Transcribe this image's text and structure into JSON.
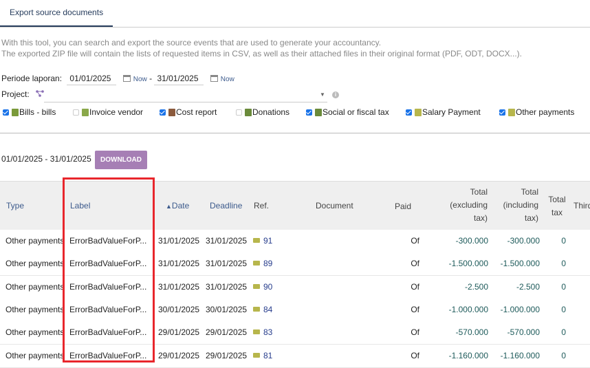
{
  "tab": {
    "label": "Export source documents"
  },
  "description": {
    "line1": "With this tool, you can search and export the source events that are used to generate your accountancy.",
    "line2": "The exported ZIP file will contain the lists of requested items in CSV, as well as their attached files in their original format (PDF, ODT, DOCX...)."
  },
  "period": {
    "label": "Periode laporan:",
    "start": "01/01/2025",
    "end": "31/01/2025",
    "separator": "-",
    "now": "Now"
  },
  "project": {
    "label": "Project:"
  },
  "types": [
    {
      "label": "Bills - bills",
      "checked": true,
      "color": "#7a9a3a"
    },
    {
      "label": "Invoice vendor",
      "checked": false,
      "color": "#8aa84a"
    },
    {
      "label": "Cost report",
      "checked": true,
      "color": "#8b5a3c"
    },
    {
      "label": "Donations",
      "checked": false,
      "color": "#6a8a3a"
    },
    {
      "label": "Social or fiscal tax",
      "checked": true,
      "color": "#6a8a3a"
    },
    {
      "label": "Salary Payment",
      "checked": true,
      "color": "#b7b64c"
    },
    {
      "label": "Other payments",
      "checked": true,
      "color": "#b7b64c"
    }
  ],
  "range_text": "01/01/2025 - 31/01/2025",
  "download_label": "DOWNLOAD",
  "columns": {
    "type": "Type",
    "label": "Label",
    "date": "Date",
    "sort_arrow": "▲",
    "deadline": "Deadline",
    "ref": "Ref.",
    "document": "Document",
    "paid": "Paid",
    "total_excl": [
      "Total",
      "(excluding",
      "tax)"
    ],
    "total_incl": [
      "Total",
      "(including",
      "tax)"
    ],
    "total_tax": [
      "Total",
      "tax"
    ],
    "third": "Third"
  },
  "rows": [
    {
      "type": "Other payments",
      "label": "ErrorBadValueForP...",
      "date": "31/01/2025",
      "deadline": "31/01/2025",
      "ref": "91",
      "paid": "Of",
      "excl": "-300.000",
      "incl": "-300.000",
      "tax": "0"
    },
    {
      "type": "Other payments",
      "label": "ErrorBadValueForP...",
      "date": "31/01/2025",
      "deadline": "31/01/2025",
      "ref": "89",
      "paid": "Of",
      "excl": "-1.500.000",
      "incl": "-1.500.000",
      "tax": "0"
    },
    {
      "type": "Other payments",
      "label": "ErrorBadValueForP...",
      "date": "31/01/2025",
      "deadline": "31/01/2025",
      "ref": "90",
      "paid": "Of",
      "excl": "-2.500",
      "incl": "-2.500",
      "tax": "0"
    },
    {
      "type": "Other payments",
      "label": "ErrorBadValueForP...",
      "date": "30/01/2025",
      "deadline": "30/01/2025",
      "ref": "84",
      "paid": "Of",
      "excl": "-1.000.000",
      "incl": "-1.000.000",
      "tax": "0"
    },
    {
      "type": "Other payments",
      "label": "ErrorBadValueForP...",
      "date": "29/01/2025",
      "deadline": "29/01/2025",
      "ref": "83",
      "paid": "Of",
      "excl": "-570.000",
      "incl": "-570.000",
      "tax": "0"
    },
    {
      "type": "Other payments",
      "label": "ErrorBadValueForP...",
      "date": "29/01/2025",
      "deadline": "29/01/2025",
      "ref": "81",
      "paid": "Of",
      "excl": "-1.160.000",
      "incl": "-1.160.000",
      "tax": "0"
    }
  ],
  "colors": {
    "accent": "#263c5c",
    "download": "#a67fb5",
    "highlight": "#e8262c",
    "amount": "#1d5a5a"
  }
}
